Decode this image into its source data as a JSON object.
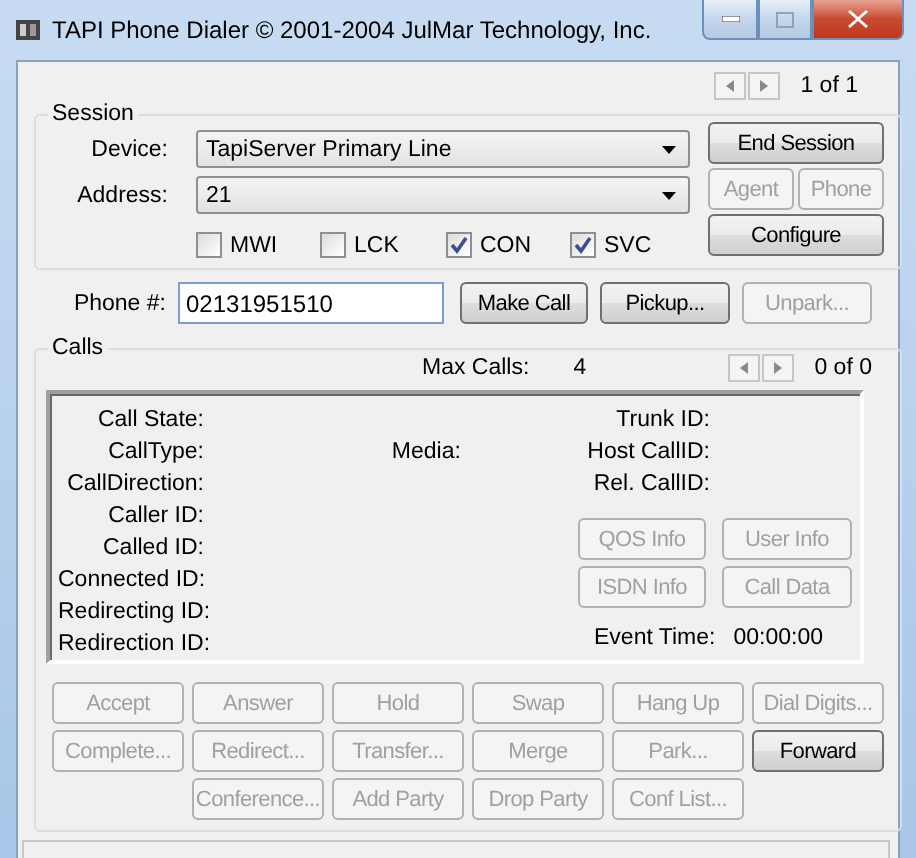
{
  "window": {
    "title": "TAPI Phone Dialer © 2001-2004 JulMar Technology, Inc."
  },
  "session_nav": {
    "text": "1 of 1"
  },
  "session": {
    "legend": "Session",
    "device": {
      "label": "Device:",
      "value": "TapiServer Primary Line"
    },
    "address": {
      "label": "Address:",
      "value": "21"
    },
    "checkboxes": [
      {
        "label": "MWI",
        "checked": false
      },
      {
        "label": "LCK",
        "checked": false
      },
      {
        "label": "CON",
        "checked": true
      },
      {
        "label": "SVC",
        "checked": true
      }
    ],
    "end_session": {
      "label": "End Session",
      "disabled": false
    },
    "small_buttons": [
      {
        "label": "Agent",
        "disabled": true
      },
      {
        "label": "Phone",
        "disabled": true
      }
    ],
    "configure": {
      "label": "Configure",
      "disabled": false
    }
  },
  "phone": {
    "label": "Phone #:",
    "value": "02131951510",
    "buttons": [
      {
        "label": "Make Call",
        "disabled": false
      },
      {
        "label": "Pickup...",
        "disabled": false
      },
      {
        "label": "Unpark...",
        "disabled": true
      }
    ]
  },
  "calls": {
    "legend": "Calls",
    "max_calls_label": "Max Calls:",
    "max_calls": "4",
    "nav_text": "0 of 0",
    "left_fields": [
      "Call State:",
      "CallType:",
      "CallDirection:",
      "Caller ID:",
      "Called ID:",
      "Connected ID:",
      "Redirecting ID:",
      "Redirection ID:"
    ],
    "media_label": "Media:",
    "right_fields": [
      "Trunk ID:",
      "Host CallID:",
      "Rel. CallID:"
    ],
    "info_buttons": [
      [
        {
          "label": "QOS Info",
          "disabled": true
        },
        {
          "label": "User Info",
          "disabled": true
        }
      ],
      [
        {
          "label": "ISDN Info",
          "disabled": true
        },
        {
          "label": "Call Data",
          "disabled": true
        }
      ]
    ],
    "event_time_label": "Event Time:",
    "event_time": "00:00:00",
    "action_rows": [
      [
        {
          "label": "Accept",
          "disabled": true
        },
        {
          "label": "Answer",
          "disabled": true
        },
        {
          "label": "Hold",
          "disabled": true
        },
        {
          "label": "Swap",
          "disabled": true
        },
        {
          "label": "Hang Up",
          "disabled": true
        },
        {
          "label": "Dial Digits...",
          "disabled": true
        }
      ],
      [
        {
          "label": "Complete...",
          "disabled": true
        },
        {
          "label": "Redirect...",
          "disabled": true
        },
        {
          "label": "Transfer...",
          "disabled": true
        },
        {
          "label": "Merge",
          "disabled": true
        },
        {
          "label": "Park...",
          "disabled": true
        },
        {
          "label": "Forward",
          "disabled": false
        }
      ],
      [
        {
          "label": "Conference...",
          "disabled": true
        },
        {
          "label": "Add Party",
          "disabled": true
        },
        {
          "label": "Drop Party",
          "disabled": true
        },
        {
          "label": "Conf List...",
          "disabled": true
        }
      ]
    ]
  }
}
